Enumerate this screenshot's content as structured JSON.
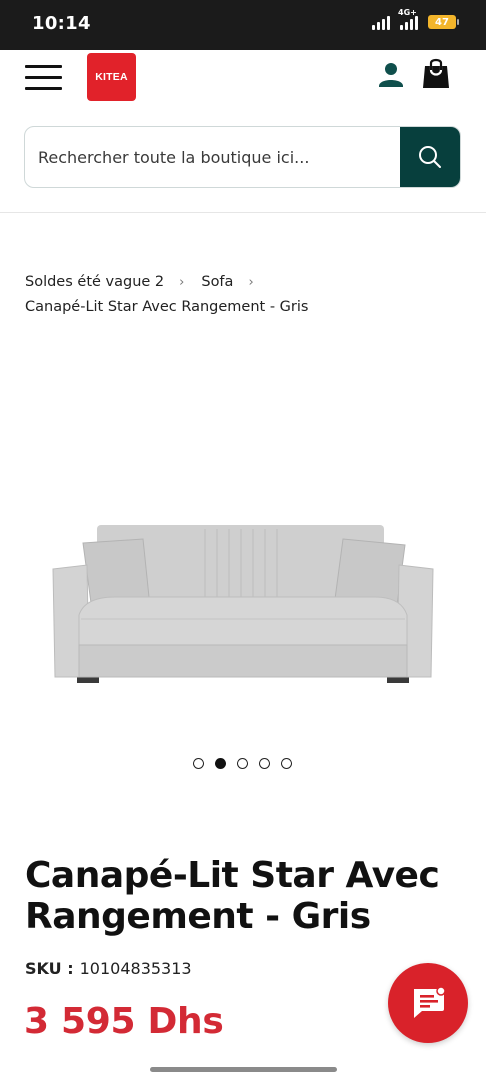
{
  "status_bar": {
    "time": "10:14",
    "network": "4G+",
    "battery": "47"
  },
  "header": {
    "logo_text": "KITEA",
    "menu_icon": "hamburger-icon",
    "account_icon": "user-icon",
    "cart_icon": "shopping-bag-icon"
  },
  "search": {
    "placeholder": "Rechercher toute la boutique ici...",
    "button_icon": "search-icon"
  },
  "breadcrumb": {
    "items": [
      {
        "label": "Soldes été vague 2"
      },
      {
        "label": "Sofa"
      }
    ],
    "current": "Canapé-Lit Star Avec Rangement - Gris"
  },
  "product": {
    "image_alt": "Canapé-Lit Star Avec Rangement - Gris",
    "carousel": {
      "count": 5,
      "active_index": 1
    },
    "title": "Canapé-Lit Star Avec Rangement - Gris",
    "sku_label": "SKU :",
    "sku": "10104835313",
    "price": "3 595 Dhs"
  },
  "chat": {
    "icon": "chat-icon"
  },
  "colors": {
    "brand_red": "#e1222a",
    "search_button": "#073f3d",
    "price": "#d32a35",
    "account_icon": "#0f4f4c"
  }
}
